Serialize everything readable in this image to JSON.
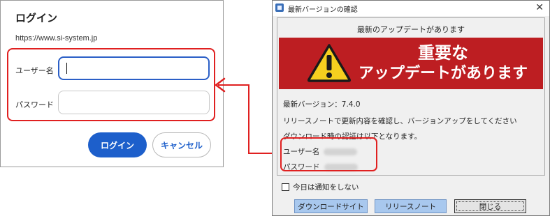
{
  "login_dialog": {
    "title": "ログイン",
    "url": "https://www.si-system.jp",
    "username_label": "ユーザー名",
    "password_label": "パスワード",
    "username_value": "",
    "password_value": "",
    "login_button": "ログイン",
    "cancel_button": "キャンセル"
  },
  "update_window": {
    "title": "最新バージョンの確認",
    "close_glyph": "✕",
    "heading": "最新のアップデートがあります",
    "banner": {
      "line1": "重要な",
      "line2": "アップデートがあります",
      "icon": "warning-icon",
      "color": "#bd1e22"
    },
    "version_text": "最新バージョン：7.4.0",
    "note_text": "リリースノートで更新内容を確認し、バージョンアップをしてください",
    "auth_text": "ダウンロード時の認証は以下となります。",
    "username_label": "ユーザー名",
    "password_label": "パスワード",
    "checkbox_label": "今日は通知をしない",
    "checkbox_checked": false,
    "buttons": {
      "download": "ダウンロードサイト",
      "release_notes": "リリースノート",
      "close": "閉じる"
    }
  },
  "colors": {
    "highlight": "#e02020",
    "primary_button": "#1d5fcb",
    "window_button": "#a8c8ee"
  }
}
